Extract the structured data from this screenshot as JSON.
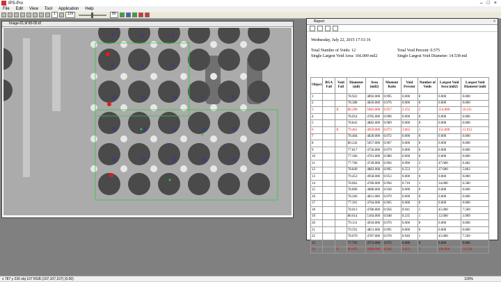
{
  "app": {
    "title": "IPS-Pro"
  },
  "menu": [
    "File",
    "Edit",
    "View",
    "Tool",
    "Application",
    "Help"
  ],
  "toolbar": {
    "frame": "1",
    "zoom": "129",
    "value": "80"
  },
  "image_window": {
    "title": "Image-01.tif 80-05.tif"
  },
  "grid_labels": [
    "3",
    "2",
    "1",
    "6",
    "5",
    "4",
    "12",
    "11",
    "10",
    "9",
    "8",
    "7",
    "13",
    "14",
    "15",
    "16",
    "17",
    "18",
    "19",
    "20",
    "21",
    "22",
    "23",
    "24"
  ],
  "report": {
    "title": "Report",
    "date": "Wednesday, July 22, 2015 17:51:16",
    "total_voids": "Total Number of Voids: 12",
    "total_void_percent": "Total Void Percent: 0.575",
    "largest_void_area": "Single Largest Void Area: 166.000 mil2",
    "largest_void_diameter": "Single Largest Void Diameter: 14.538 mil",
    "columns": [
      "Object",
      "BGA Fail",
      "Void Fail",
      "Diameter (mil)",
      "Area (mil2)",
      "Moment Ratio",
      "Void Percent",
      "Number of Voids",
      "Largest Void Area (mil2)",
      "Largest Void Diameter (mil)"
    ],
    "rows": [
      [
        "1",
        "",
        "",
        "78.922",
        "4892.000",
        "0.995",
        "0.000",
        "0",
        "0.000",
        "0.000"
      ],
      [
        "2",
        "",
        "",
        "78.388",
        "4826.000",
        "0.976",
        "0.000",
        "0",
        "0.000",
        "0.000"
      ],
      [
        "3",
        "",
        "X",
        "80.290",
        "5063.000",
        "0.957",
        "2.252",
        "2",
        "114.000",
        "10.211"
      ],
      [
        "4",
        "",
        "",
        "78.054",
        "4785.000",
        "0.990",
        "0.000",
        "0",
        "0.000",
        "0.000"
      ],
      [
        "5",
        "",
        "",
        "78.841",
        "4882.000",
        "0.989",
        "0.000",
        "0",
        "0.000",
        "0.000"
      ],
      [
        "6",
        "",
        "X",
        "79.461",
        "4959.000",
        "0.973",
        "3.065",
        "1",
        "152.000",
        "13.912"
      ],
      [
        "7",
        "",
        "",
        "78.404",
        "4828.000",
        "0.972",
        "0.000",
        "0",
        "0.000",
        "0.000"
      ],
      [
        "8",
        "",
        "",
        "80.242",
        "5057.000",
        "0.967",
        "0.000",
        "0",
        "0.000",
        "0.000"
      ],
      [
        "9",
        "",
        "",
        "77.817",
        "4756.000",
        "0.979",
        "0.000",
        "0",
        "0.000",
        "0.000"
      ],
      [
        "10",
        "",
        "",
        "77.366",
        "4701.000",
        "0.980",
        "0.000",
        "0",
        "0.000",
        "0.000"
      ],
      [
        "11",
        "",
        "",
        "77.760",
        "4749.000",
        "0.994",
        "0.990",
        "2",
        "47.000",
        "6.482"
      ],
      [
        "12",
        "",
        "",
        "78.849",
        "4883.000",
        "0.995",
        "0.553",
        "1",
        "27.000",
        "5.863"
      ],
      [
        "13",
        "",
        "",
        "79.453",
        "4958.000",
        "0.953",
        "0.000",
        "0",
        "0.000",
        "0.000"
      ],
      [
        "14",
        "",
        "",
        "78.062",
        "4786.000",
        "0.994",
        "0.710",
        "1",
        "34.000",
        "6.580"
      ],
      [
        "15",
        "",
        "",
        "78.890",
        "4888.000",
        "0.938",
        "0.000",
        "0",
        "0.000",
        "0.000"
      ],
      [
        "16",
        "",
        "",
        "78.266",
        "4811.000",
        "0.979",
        "0.000",
        "0",
        "0.000",
        "0.000"
      ],
      [
        "17",
        "",
        "",
        "77.391",
        "4704.000",
        "0.965",
        "0.000",
        "0",
        "0.000",
        "0.000"
      ],
      [
        "18",
        "",
        "",
        "78.013",
        "4780.000",
        "0.956",
        "0.941",
        "1",
        "45.000",
        "7.569"
      ],
      [
        "19",
        "",
        "",
        "80.614",
        "5104.000",
        "0.948",
        "0.235",
        "1",
        "12.000",
        "3.909"
      ],
      [
        "20",
        "",
        "",
        "79.131",
        "4918.000",
        "0.976",
        "0.000",
        "0",
        "0.000",
        "0.000"
      ],
      [
        "21",
        "",
        "",
        "79.591",
        "4851.000",
        "0.995",
        "0.000",
        "0",
        "0.000",
        "0.000"
      ],
      [
        "22",
        "",
        "",
        "78.070",
        "4787.000",
        "0.978",
        "0.940",
        "1",
        "45.000",
        "7.569"
      ],
      [
        "23",
        "",
        "",
        "77.793",
        "4753.000",
        "0.972",
        "0.000",
        "0",
        "0.000",
        "0.000"
      ],
      [
        "24",
        "",
        "X",
        "80.495",
        "5089.000",
        "0.946",
        "3.851",
        "2",
        "196.000",
        "14.538"
      ]
    ]
  },
  "status": {
    "text": "x 787  y 236  obj 107  RGB (107,107,107)  (0.00)",
    "zoom": "100%"
  }
}
